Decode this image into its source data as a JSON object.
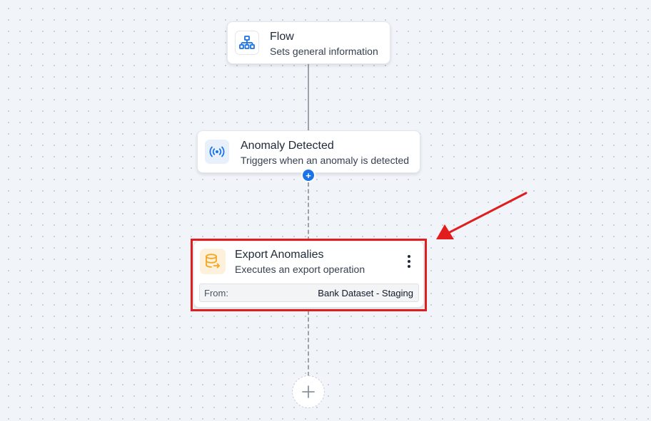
{
  "canvas": {
    "background": "#f1f5f9",
    "dot_color": "#c4ccd6"
  },
  "nodes": {
    "flow": {
      "title": "Flow",
      "subtitle": "Sets general information",
      "icon": "sitemap-icon",
      "icon_color": "#1a73e8"
    },
    "anomaly_detected": {
      "title": "Anomaly Detected",
      "subtitle": "Triggers when an anomaly is detected",
      "icon": "broadcast-signal-icon",
      "icon_color": "#1a73e8"
    },
    "export_anomalies": {
      "title": "Export Anomalies",
      "subtitle": "Executes an export operation",
      "icon": "database-export-icon",
      "icon_color": "#f5a623",
      "from_label": "From:",
      "from_value": "Bank Dataset - Staging",
      "menu_icon": "more-vertical-icon"
    }
  },
  "connector_add_badge": {
    "symbol": "+",
    "color": "#1a73e8"
  },
  "add_step_button": {
    "icon": "plus-icon"
  },
  "annotation": {
    "color": "#e11d1d",
    "shapes": [
      "highlight-box",
      "arrow"
    ]
  }
}
